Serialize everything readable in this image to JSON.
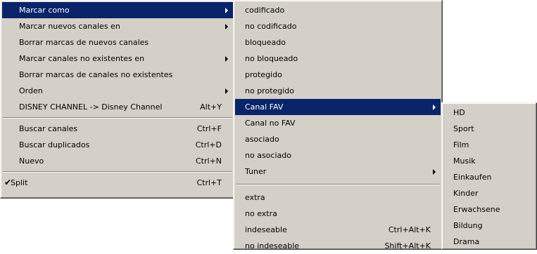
{
  "menu_main": {
    "items": [
      {
        "label": "Marcar como",
        "shortcut": "",
        "submenu": true,
        "selected": true
      },
      {
        "label": "Marcar nuevos canales en",
        "shortcut": "",
        "submenu": true
      },
      {
        "label": "Borrar marcas de nuevos canales",
        "shortcut": "",
        "submenu": false
      },
      {
        "label": "Marcar canales no existentes en",
        "shortcut": "",
        "submenu": true
      },
      {
        "label": "Borrar marcas de canales no existentes",
        "shortcut": "",
        "submenu": false
      },
      {
        "label": "Orden",
        "shortcut": "",
        "submenu": true
      },
      {
        "label": "DISNEY CHANNEL -> Disney Channel",
        "shortcut": "Alt+Y",
        "submenu": false
      },
      {
        "label": "Buscar canales",
        "shortcut": "Ctrl+F",
        "submenu": false
      },
      {
        "label": "Buscar duplicados",
        "shortcut": "Ctrl+D",
        "submenu": false
      },
      {
        "label": "Nuevo",
        "shortcut": "Ctrl+N",
        "submenu": false
      },
      {
        "label": "Split",
        "shortcut": "Ctrl+T",
        "submenu": false,
        "checked": true,
        "check_glyph": "✔"
      }
    ]
  },
  "menu_marcar_como": {
    "items": [
      {
        "label": "codificado"
      },
      {
        "label": "no codificado"
      },
      {
        "label": "bloqueado"
      },
      {
        "label": "no bloqueado"
      },
      {
        "label": "protegido"
      },
      {
        "label": "no protegido"
      },
      {
        "label": "Canal FAV",
        "submenu": true,
        "selected": true
      },
      {
        "label": "Canal no FAV"
      },
      {
        "label": "asociado"
      },
      {
        "label": "no asociado"
      },
      {
        "label": "Tuner",
        "submenu": true
      },
      {
        "label": "extra"
      },
      {
        "label": "no extra"
      },
      {
        "label": "indeseable",
        "shortcut": "Ctrl+Alt+K"
      },
      {
        "label": "no indeseable",
        "shortcut": "Shift+Alt+K"
      }
    ]
  },
  "menu_canal_fav": {
    "items": [
      {
        "label": "HD"
      },
      {
        "label": "Sport"
      },
      {
        "label": "Film"
      },
      {
        "label": "Musik"
      },
      {
        "label": "Einkaufen"
      },
      {
        "label": "Kinder"
      },
      {
        "label": "Erwachsene"
      },
      {
        "label": "Bildung"
      },
      {
        "label": "Drama"
      }
    ]
  },
  "colors": {
    "menu_bg": "#d4d0c8",
    "highlight_bg": "#0a246a",
    "highlight_text": "#ffffff"
  }
}
